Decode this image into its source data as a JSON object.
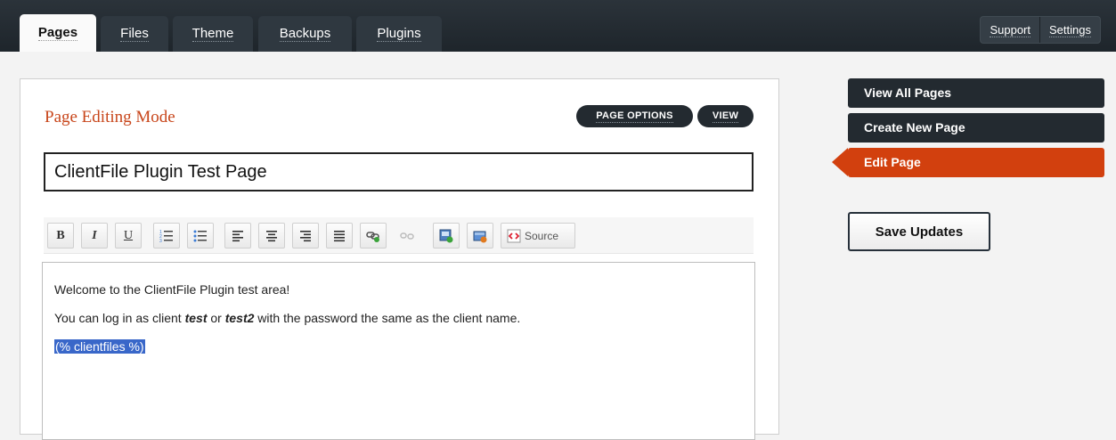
{
  "tabs": [
    {
      "label": "Pages",
      "active": true
    },
    {
      "label": "Files",
      "active": false
    },
    {
      "label": "Theme",
      "active": false
    },
    {
      "label": "Backups",
      "active": false
    },
    {
      "label": "Plugins",
      "active": false
    }
  ],
  "top_links": {
    "support": "Support",
    "settings": "Settings"
  },
  "editor_panel": {
    "mode_title": "Page Editing Mode",
    "page_options_label": "PAGE OPTIONS",
    "view_label": "VIEW",
    "page_title_value": "ClientFile Plugin Test Page",
    "toolbar": {
      "bold": "B",
      "italic": "I",
      "underline": "U",
      "source_label": "Source",
      "icons": [
        "bold-icon",
        "italic-icon",
        "underline-icon",
        "ordered-list-icon",
        "unordered-list-icon",
        "align-left-icon",
        "align-center-icon",
        "align-right-icon",
        "justify-icon",
        "link-icon",
        "unlink-icon",
        "insert-image-icon",
        "insert-html-icon",
        "source-icon"
      ]
    },
    "content": {
      "p1": "Welcome to the ClientFile Plugin test area!",
      "p2_prefix": "You can log in as client ",
      "p2_user1": "test",
      "p2_or": " or ",
      "p2_user2": "test2",
      "p2_suffix": " with the password the same as the client name.",
      "p3_selected": "(% clientfiles %)"
    }
  },
  "side_nav": {
    "items": [
      {
        "label": "View All Pages",
        "active": false
      },
      {
        "label": "Create New Page",
        "active": false
      },
      {
        "label": "Edit Page",
        "active": true
      }
    ],
    "save_label": "Save Updates"
  },
  "colors": {
    "topbar": "#222a31",
    "accent": "#d2400e",
    "mode_title": "#c8461b",
    "nav_dark": "#232a30",
    "selection": "#3967c9"
  }
}
